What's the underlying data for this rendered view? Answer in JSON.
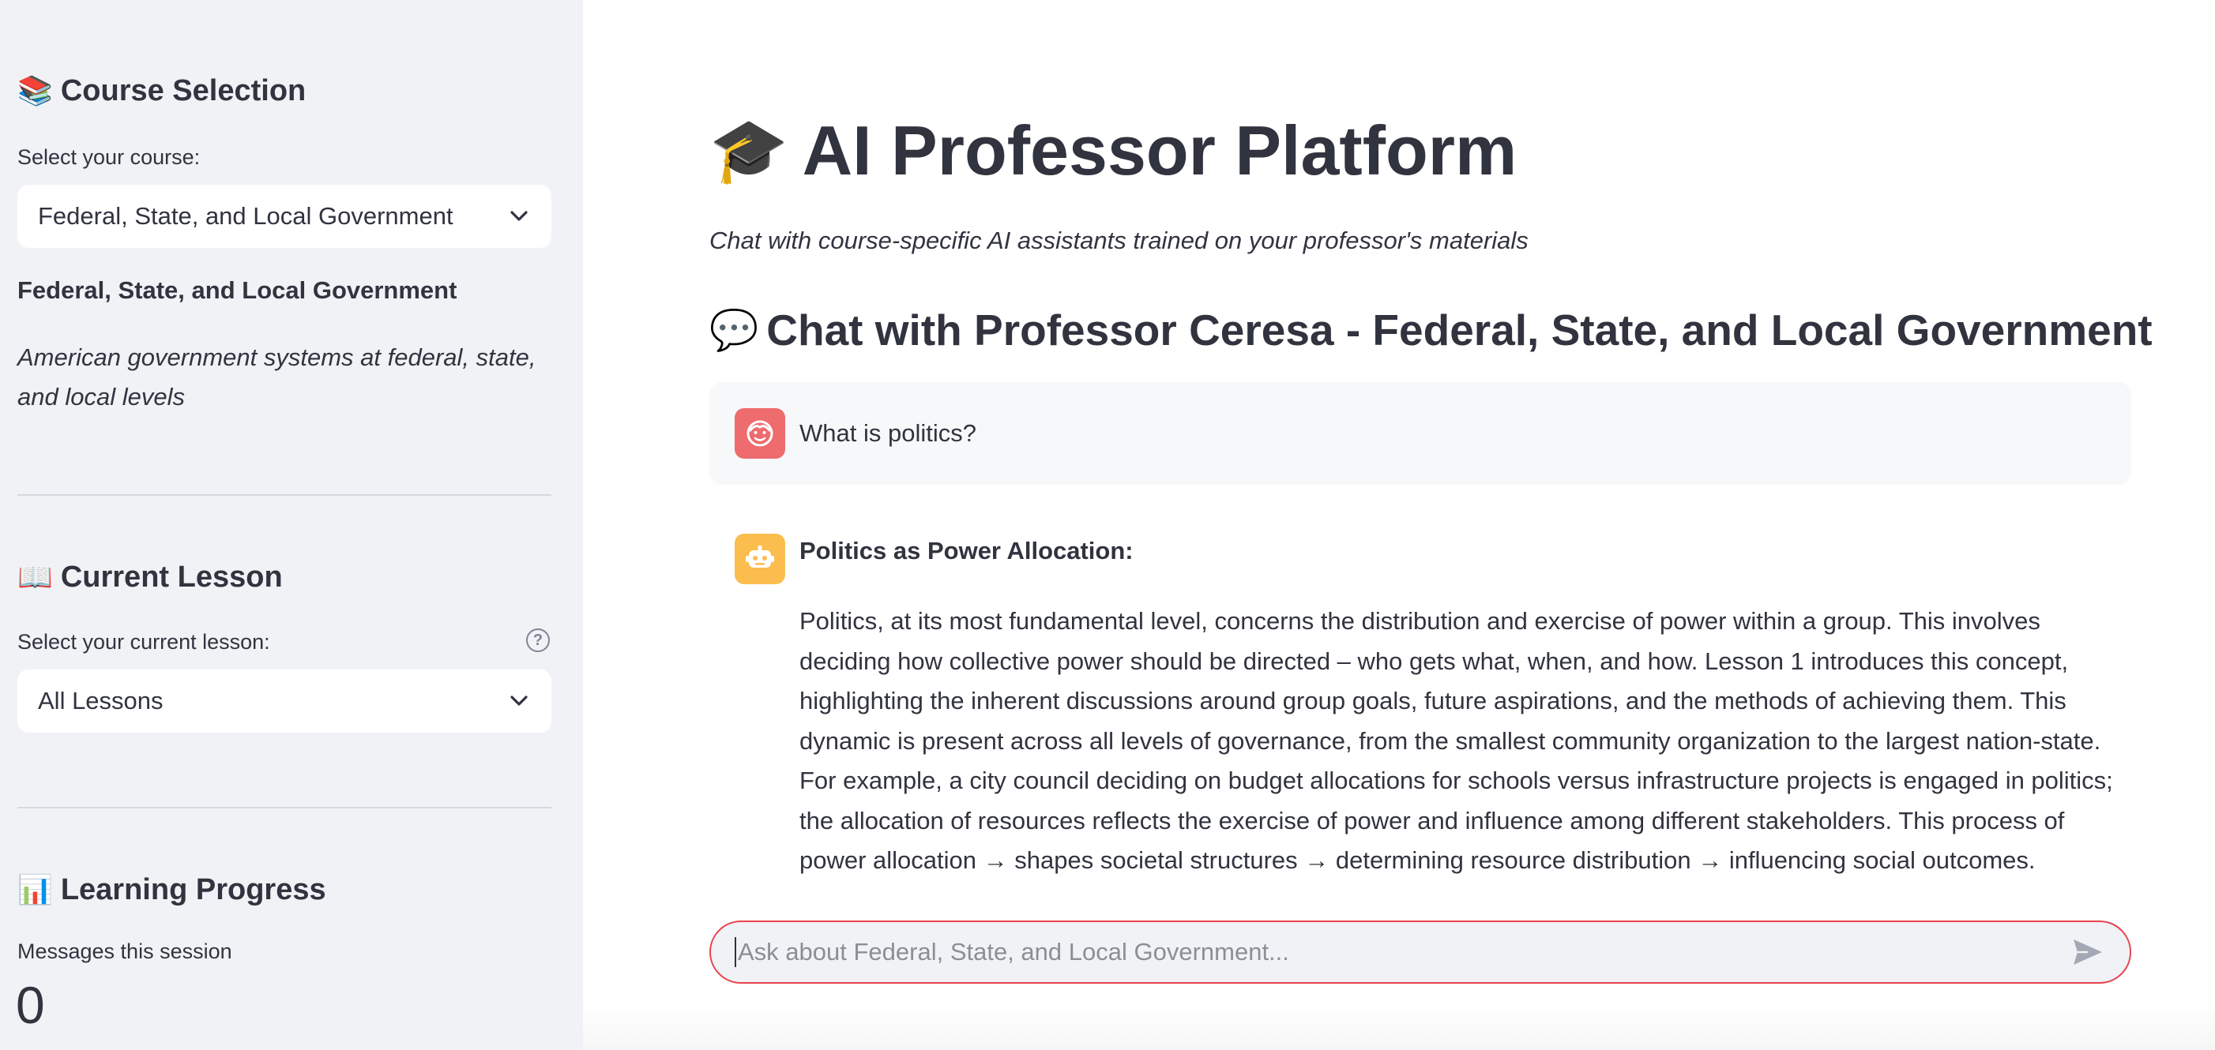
{
  "sidebar": {
    "course_section": {
      "emoji": "📚",
      "title": "Course Selection",
      "select_label": "Select your course:",
      "selected_course": "Federal, State, and Local Government"
    },
    "course_info": {
      "name": "Federal, State, and Local Government",
      "description": "American government systems at federal, state, and local levels"
    },
    "lesson_section": {
      "emoji": "📖",
      "title": "Current Lesson",
      "select_label": "Select your current lesson:",
      "selected_lesson": "All Lessons"
    },
    "progress_section": {
      "emoji": "📊",
      "title": "Learning Progress",
      "metric_label": "Messages this session",
      "metric_value": "0"
    }
  },
  "main": {
    "title_emoji": "🎓",
    "title": "AI Professor Platform",
    "subtitle": "Chat with course-specific AI assistants trained on your professor's materials",
    "chat_heading_emoji": "💬",
    "chat_heading": "Chat with Professor Ceresa - Federal, State, and Local Government",
    "messages": [
      {
        "role": "user",
        "text": "What is politics?"
      },
      {
        "role": "assistant",
        "title": "Politics as Power Allocation:",
        "body": "Politics, at its most fundamental level, concerns the distribution and exercise of power within a group. This involves deciding how collective power should be directed – who gets what, when, and how. Lesson 1 introduces this concept, highlighting the inherent discussions around group goals, future aspirations, and the methods of achieving them. This dynamic is present across all levels of governance, from the smallest community organization to the largest nation-state. For example, a city council deciding on budget allocations for schools versus infrastructure projects is engaged in politics; the allocation of resources reflects the exercise of power and influence among different stakeholders. This process of power allocation → shapes societal structures → determining resource distribution → influencing social outcomes."
      }
    ],
    "chat_input": {
      "placeholder": "Ask about Federal, State, and Local Government...",
      "value": ""
    }
  },
  "icons": {
    "user_avatar": "smiley-face-icon",
    "assistant_avatar": "robot-icon",
    "send": "send-arrow-icon",
    "help": "question-circle-icon",
    "select": "chevron-down-icon"
  },
  "colors": {
    "sidebar_bg": "#f0f2f6",
    "user_avatar": "#ee6b6e",
    "assistant_avatar": "#fbbd4d",
    "input_border": "#e8424b",
    "text": "#31333f"
  }
}
